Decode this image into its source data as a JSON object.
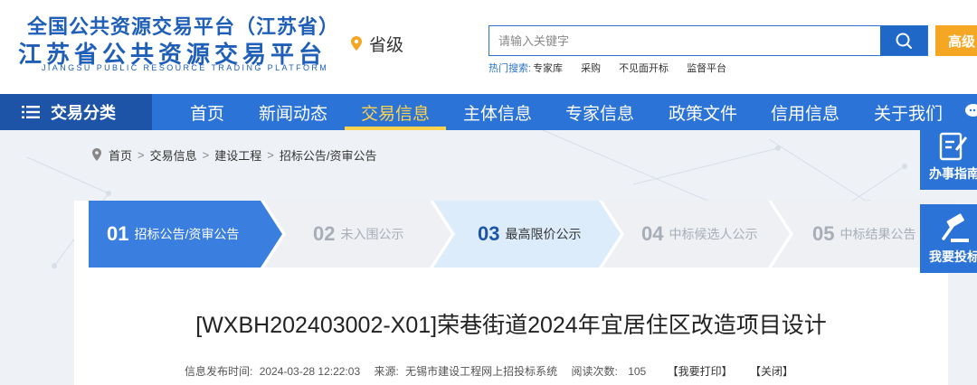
{
  "header": {
    "logo_line1": "全国公共资源交易平台（江苏省）",
    "logo_line2": "江苏省公共资源交易平台",
    "logo_line3": "JIANGSU PUBLIC RESOURCE TRADING PLATFORM",
    "region": "省级",
    "search": {
      "placeholder": "请输入关键字",
      "advanced_label": "高级"
    },
    "hot_label": "热门搜索:",
    "hot_items": [
      "专家库",
      "采购",
      "不见面开标",
      "监督平台"
    ]
  },
  "nav": {
    "category_label": "交易分类",
    "items": [
      "首页",
      "新闻动态",
      "交易信息",
      "主体信息",
      "专家信息",
      "政策文件",
      "信用信息",
      "关于我们"
    ],
    "active_index": 2
  },
  "breadcrumb": [
    "首页",
    "交易信息",
    "建设工程",
    "招标公告/资审公告"
  ],
  "steps": [
    {
      "num": "01",
      "label": "招标公告/资审公告",
      "state": "active"
    },
    {
      "num": "02",
      "label": "未入围公示",
      "state": "inactive"
    },
    {
      "num": "03",
      "label": "最高限价公示",
      "state": "highlight"
    },
    {
      "num": "04",
      "label": "中标候选人公示",
      "state": "inactive"
    },
    {
      "num": "05",
      "label": "中标结果公告",
      "state": "inactive"
    }
  ],
  "article": {
    "title": "[WXBH202403002-X01]荣巷街道2024年宜居住区改造项目设计",
    "publish_time_label": "信息发布时间:",
    "publish_time": "2024-03-28 12:22:03",
    "source_label": "来源:",
    "source": "无锡市建设工程网上招投标系统",
    "views_label": "阅读次数:",
    "views": "105",
    "print_label": "【我要打印】",
    "close_label": "【关闭】"
  },
  "side": {
    "guide_label": "办事指南",
    "bid_label": "我要投标"
  },
  "colors": {
    "primary": "#2b73d6",
    "nav_dark": "#1d54a8",
    "active": "#ffd24d",
    "step_active": "#3a7fe0",
    "step_highlight": "#dcecfb",
    "step_inactive": "#eef0f3",
    "advanced": "#f5a623"
  }
}
